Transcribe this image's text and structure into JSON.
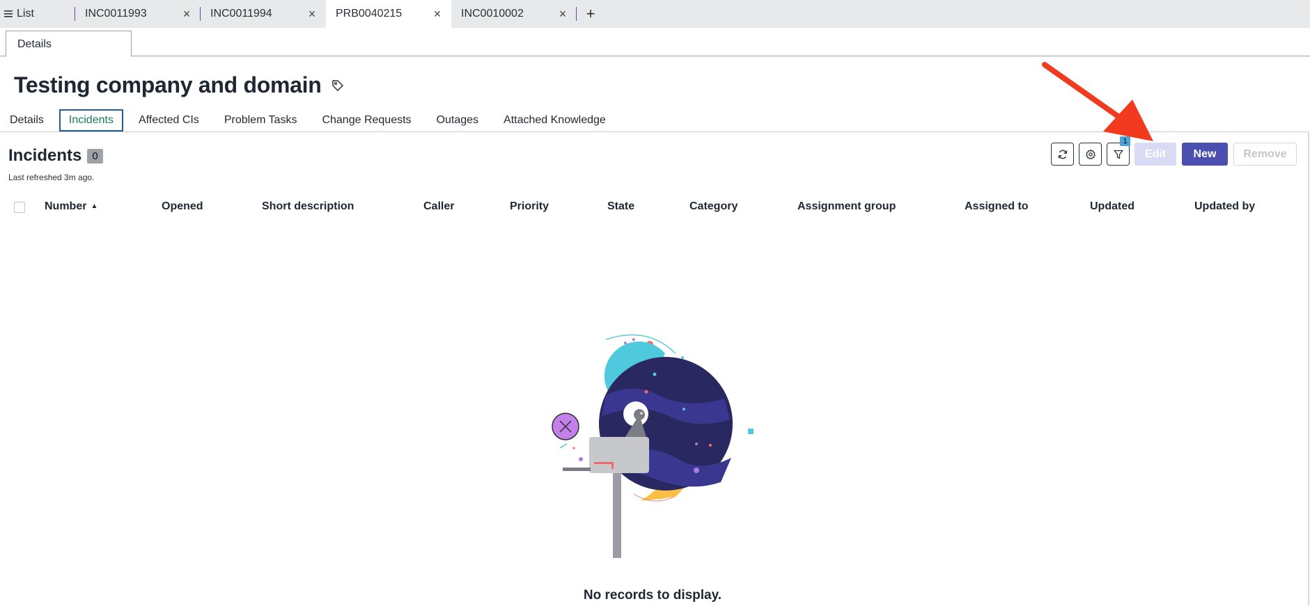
{
  "top_tabs": {
    "list_label": "List",
    "tabs": [
      {
        "label": "INC0011993"
      },
      {
        "label": "INC0011994"
      },
      {
        "label": "PRB0040215"
      },
      {
        "label": "INC0010002"
      }
    ],
    "close_glyph": "×",
    "add_glyph": "+"
  },
  "sub_tab": {
    "label": "Details"
  },
  "record": {
    "title": "Testing company and domain"
  },
  "related_tabs": [
    {
      "label": "Details"
    },
    {
      "label": "Incidents"
    },
    {
      "label": "Affected CIs"
    },
    {
      "label": "Problem Tasks"
    },
    {
      "label": "Change Requests"
    },
    {
      "label": "Outages"
    },
    {
      "label": "Attached Knowledge"
    }
  ],
  "related_list": {
    "title": "Incidents",
    "count": "0",
    "refresh_note": "Last refreshed 3m ago.",
    "filter_count": "1",
    "buttons": {
      "edit": "Edit",
      "new": "New",
      "remove": "Remove"
    },
    "columns": [
      {
        "label": "Number"
      },
      {
        "label": "Opened"
      },
      {
        "label": "Short description"
      },
      {
        "label": "Caller"
      },
      {
        "label": "Priority"
      },
      {
        "label": "State"
      },
      {
        "label": "Category"
      },
      {
        "label": "Assignment group"
      },
      {
        "label": "Assigned to"
      },
      {
        "label": "Updated"
      },
      {
        "label": "Updated by"
      }
    ],
    "sort_glyph": "▲",
    "empty_message": "No records to display."
  },
  "colors": {
    "primary": "#4a4fb0",
    "active_tab_border": "#1f5fa0",
    "active_tab_text": "#1a7a5e",
    "annotation_arrow": "#f23a1e"
  },
  "icons": [
    "list-icon",
    "close-icon",
    "plus-icon",
    "tag-icon",
    "refresh-icon",
    "gear-icon",
    "filter-icon"
  ]
}
